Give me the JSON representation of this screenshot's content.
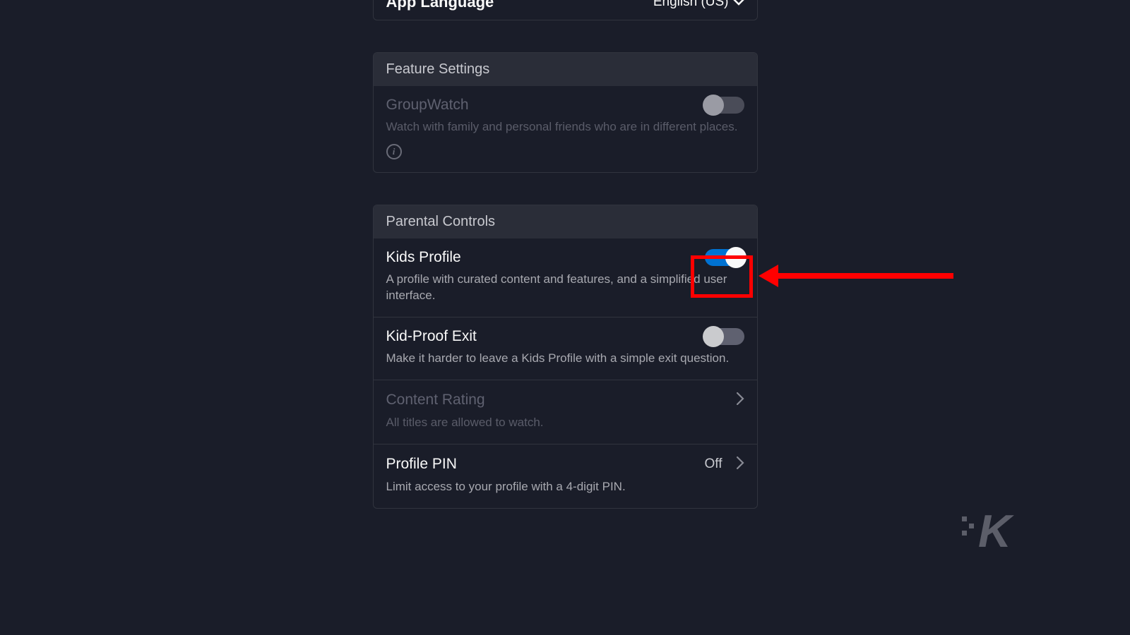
{
  "language": {
    "label": "App Language",
    "value": "English (US)"
  },
  "feature_settings": {
    "header": "Feature Settings",
    "groupwatch": {
      "title": "GroupWatch",
      "desc": "Watch with family and personal friends who are in different places."
    }
  },
  "parental_controls": {
    "header": "Parental Controls",
    "kids_profile": {
      "title": "Kids Profile",
      "desc": "A profile with curated content and features, and a simplified user interface."
    },
    "kid_proof_exit": {
      "title": "Kid-Proof Exit",
      "desc": "Make it harder to leave a Kids Profile with a simple exit question."
    },
    "content_rating": {
      "title": "Content Rating",
      "desc": "All titles are allowed to watch."
    },
    "profile_pin": {
      "title": "Profile PIN",
      "value": "Off",
      "desc": "Limit access to your profile with a 4-digit PIN."
    }
  },
  "annotation": {
    "highlight_color": "#ff0000"
  }
}
